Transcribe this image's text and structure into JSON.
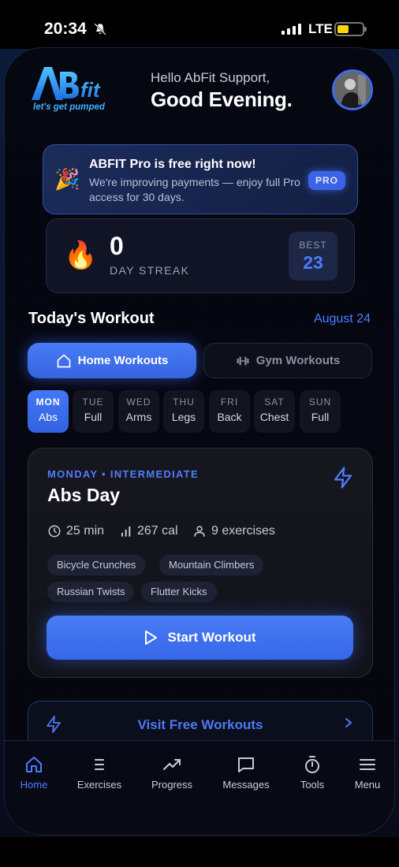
{
  "status_bar": {
    "time": "20:34",
    "network": "LTE"
  },
  "header": {
    "logo_letters": "ABfit",
    "logo_tagline": "let's get pumped",
    "hello": "Hello AbFit Support,",
    "greeting": "Good Evening."
  },
  "pro_banner": {
    "emoji": "🎉",
    "title": "ABFIT Pro is free right now!",
    "subtitle": "We're improving payments — enjoy full Pro access for 30 days.",
    "badge": "PRO"
  },
  "streak": {
    "emoji": "🔥",
    "count": "0",
    "label": "DAY STREAK",
    "best_label": "BEST",
    "best_value": "23"
  },
  "workout_section": {
    "title": "Today's Workout",
    "date": "August 24",
    "tabs": [
      {
        "label": "Home Workouts",
        "icon": "home-icon",
        "active": true
      },
      {
        "label": "Gym Workouts",
        "icon": "dumbbell-icon",
        "active": false
      }
    ],
    "days": [
      {
        "day": "MON",
        "focus": "Abs",
        "active": true
      },
      {
        "day": "TUE",
        "focus": "Full",
        "active": false
      },
      {
        "day": "WED",
        "focus": "Arms",
        "active": false
      },
      {
        "day": "THU",
        "focus": "Legs",
        "active": false
      },
      {
        "day": "FRI",
        "focus": "Back",
        "active": false
      },
      {
        "day": "SAT",
        "focus": "Chest",
        "active": false
      },
      {
        "day": "SUN",
        "focus": "Full",
        "active": false
      }
    ]
  },
  "workout_card": {
    "tag": "MONDAY • INTERMEDIATE",
    "title": "Abs Day",
    "duration": "25 min",
    "calories": "267 cal",
    "exercises": "9 exercises",
    "chips": [
      "Bicycle Crunches",
      "Mountain Climbers",
      "Russian Twists",
      "Flutter Kicks"
    ],
    "start_label": "Start Workout"
  },
  "visit": {
    "label": "Visit Free Workouts"
  },
  "nav": {
    "items": [
      {
        "label": "Home",
        "icon": "home-icon",
        "active": true
      },
      {
        "label": "Exercises",
        "icon": "list-icon",
        "active": false
      },
      {
        "label": "Progress",
        "icon": "trending-up-icon",
        "active": false
      },
      {
        "label": "Messages",
        "icon": "message-icon",
        "active": false
      },
      {
        "label": "Tools",
        "icon": "stopwatch-icon",
        "active": false
      },
      {
        "label": "Menu",
        "icon": "menu-icon",
        "active": false
      }
    ]
  },
  "colors": {
    "accent": "#4a7cf7",
    "background": "#05070f",
    "card": "#16171f"
  }
}
